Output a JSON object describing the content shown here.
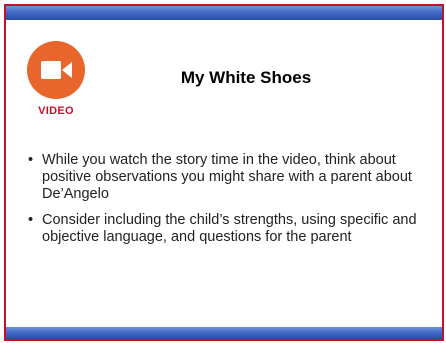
{
  "slide": {
    "title": "My White Shoes",
    "badge": {
      "icon": "video-camera-icon",
      "label": "VIDEO",
      "circle_color": "#e8662b",
      "label_color": "#c8102e"
    },
    "bullets": [
      "While you watch the story time in the video, think about positive observations you might share with a parent about De’Angelo",
      "Consider including the child’s strengths, using specific and objective language, and questions for the parent"
    ],
    "bullet_glyph": "•",
    "colors": {
      "border": "#c8102e",
      "bar": "#3f68c4"
    }
  }
}
